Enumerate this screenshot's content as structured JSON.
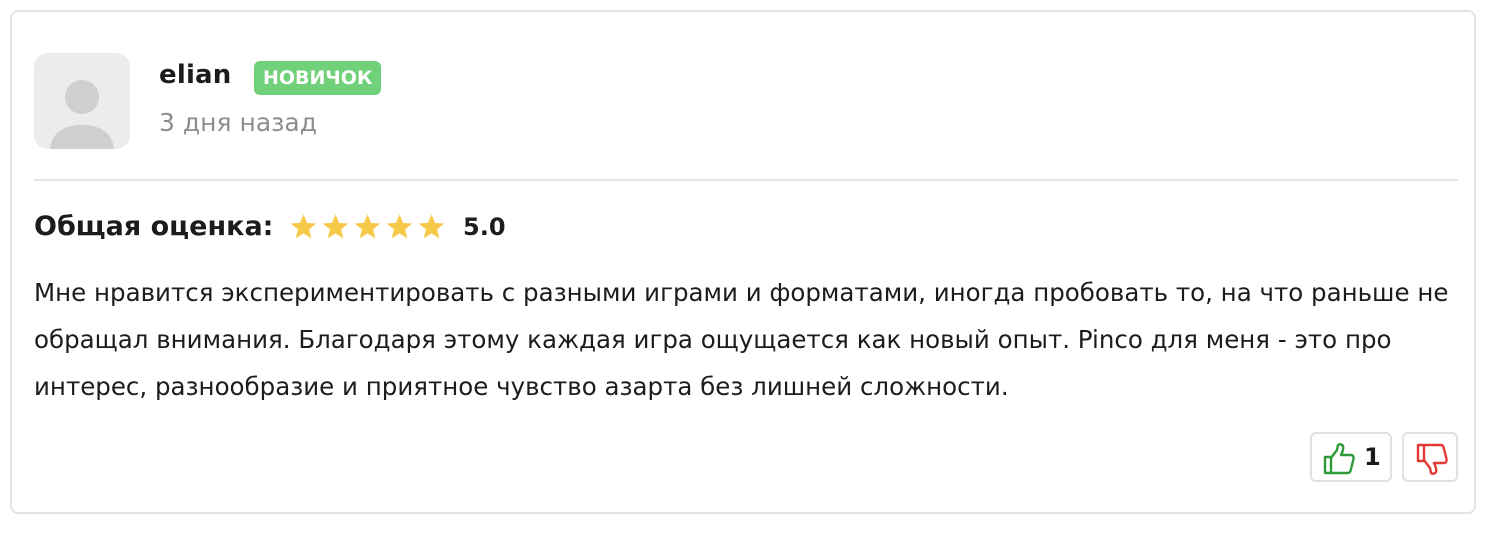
{
  "review": {
    "author": {
      "name": "elian",
      "badge": "НОВИЧОК",
      "posted_ago": "3 дня назад",
      "avatar_icon": "user-placeholder-icon"
    },
    "rating": {
      "label": "Общая оценка:",
      "stars": 5,
      "max_stars": 5,
      "value": "5.0"
    },
    "text": "Мне нравится экспериментировать с разными играми и форматами, иногда пробовать то, на что раньше не обращал внимания. Благодаря этому каждая игра ощущается как новый опыт. Pinco для меня - это про интерес, разнообразие и приятное чувство азарта без лишней сложности.",
    "votes": {
      "likes": "1",
      "like_icon": "thumbs-up-icon",
      "dislike_icon": "thumbs-down-icon"
    }
  },
  "colors": {
    "badge_bg": "#71d07a",
    "star": "#f7c94b",
    "like": "#2e9a3a",
    "dislike": "#e53935",
    "avatar_bg": "#ececec"
  }
}
